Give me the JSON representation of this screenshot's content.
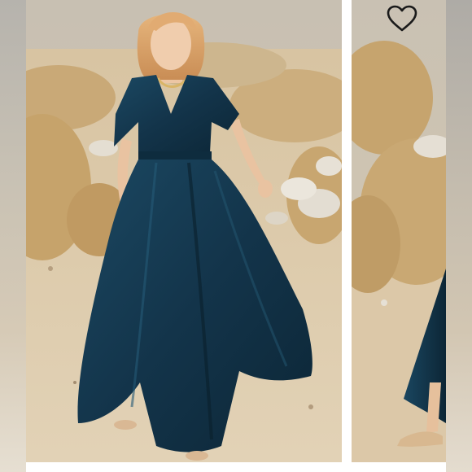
{
  "gallery": {
    "like_icon": "heart-outline-icon",
    "colors": {
      "dress": "#13344a",
      "sand": "#d7c3a2",
      "brush": "#c9a46a",
      "sky": "#cfc6b6",
      "heart_stroke": "#1a1a1a"
    }
  }
}
